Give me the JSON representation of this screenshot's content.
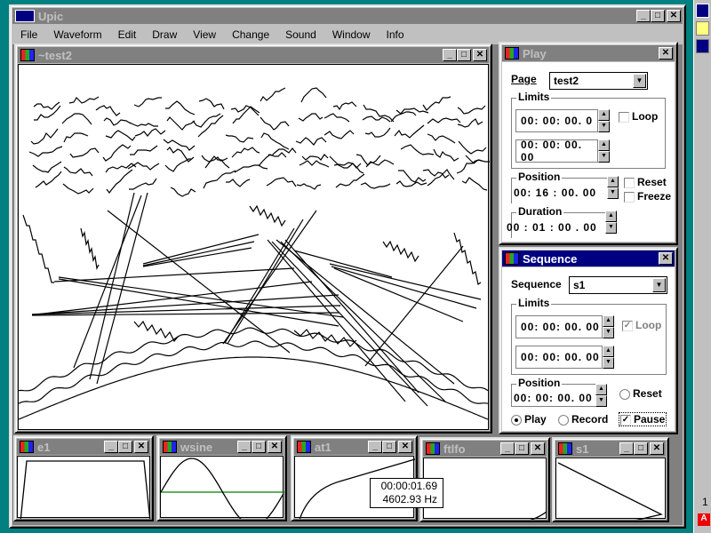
{
  "app": {
    "title": "Upic"
  },
  "menu": [
    "File",
    "Waveform",
    "Edit",
    "Draw",
    "View",
    "Change",
    "Sound",
    "Window",
    "Info"
  ],
  "page_window": {
    "title": "~test2"
  },
  "play": {
    "title": "Play",
    "page_label": "Page",
    "page_value": "test2",
    "limits_label": "Limits",
    "limit_start": "00: 00: 00. 0",
    "limit_end": "00: 00: 00. 00",
    "loop_label": "Loop",
    "loop_checked": false,
    "position_label": "Position",
    "position_value": "00: 16 : 00.  00",
    "reset_label": "Reset",
    "freeze_label": "Freeze",
    "duration_label": "Duration",
    "duration_value": "00 : 01 : 00 .  00"
  },
  "sequence": {
    "title": "Sequence",
    "sequence_label": "Sequence",
    "sequence_value": "s1",
    "limits_label": "Limits",
    "limit_start": "00: 00: 00. 00",
    "limit_end": "00: 00: 00. 00",
    "loop_label": "Loop",
    "loop_checked": true,
    "position_label": "Position",
    "position_value": "00: 00: 00. 00",
    "reset_label": "Reset",
    "play_label": "Play",
    "record_label": "Record",
    "pause_label": "Pause",
    "pause_checked": true
  },
  "waveforms": [
    {
      "title": "e1"
    },
    {
      "title": "wsine"
    },
    {
      "title": "at1"
    },
    {
      "title": "ftlfo"
    },
    {
      "title": "s1"
    }
  ],
  "tooltip": {
    "time": "00:00:01.69",
    "freq": "4602.93 Hz"
  },
  "taskbar": {
    "text": "1"
  },
  "colors": {
    "desktop": "#008080",
    "active_title": "#000080",
    "inactive_title": "#808080",
    "sine_axis": "#008000"
  }
}
